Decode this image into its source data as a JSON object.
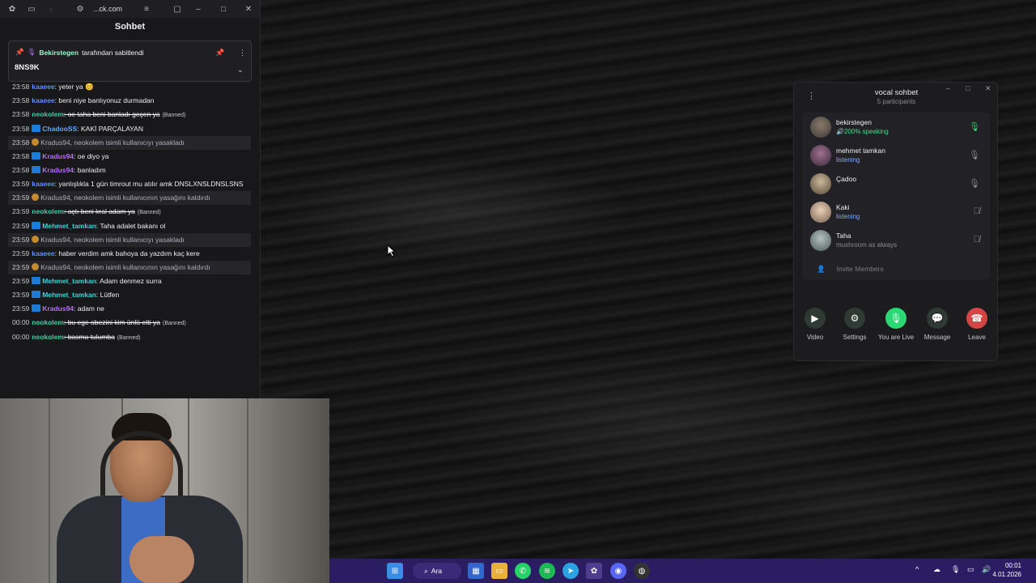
{
  "browser": {
    "url": "...ck.com"
  },
  "chat": {
    "title": "Sohbet",
    "pinned": {
      "user": "Bekirstegen",
      "suffix": " tarafından sabitlendi",
      "message": "8NS9K"
    },
    "messages": [
      {
        "time": "23:58",
        "user": "kaaeee",
        "color": "#5f8cff",
        "text": ": yeter ya 😊"
      },
      {
        "time": "23:58",
        "user": "kaaeee",
        "color": "#5f8cff",
        "text": ": beni niye banlıyonuz durmadan"
      },
      {
        "time": "23:58",
        "user": "neokolem",
        "color": "#2fd3a7",
        "text": ": oe taha beni banladı geçen ya",
        "banned": "(Banned)"
      },
      {
        "time": "23:58",
        "user": "ChadooSS",
        "color": "#5fa8ff",
        "text": ": KAKİ PARÇALAYAN"
      },
      {
        "time": "23:58",
        "sys": "Kradus94, neokolem isimli kullanıcıyı yasakladı"
      },
      {
        "time": "23:58",
        "user": "Kradus94",
        "color": "#b66bff",
        "text": ": oe diyo ya"
      },
      {
        "time": "23:58",
        "user": "Kradus94",
        "color": "#b66bff",
        "text": ": banladım"
      },
      {
        "time": "23:59",
        "user": "kaaeee",
        "color": "#5f8cff",
        "text": ": yanlışlıkla 1 gün timrout mu atılır amk DNSLXNSLDNSLSNS"
      },
      {
        "time": "23:59",
        "sys": "Kradus94, neokolem isimli kullanıcının yasağını kaldırdı"
      },
      {
        "time": "23:59",
        "user": "neokolem",
        "color": "#2fd3a7",
        "text": ": açtı beni kral adam ya",
        "banned": "(Banned)"
      },
      {
        "time": "23:59",
        "user": "Mehmet_tamkan",
        "color": "#33d6d6",
        "text": ": Taha adalet bakanı ol"
      },
      {
        "time": "23:59",
        "sys": "Kradus94, neokolem isimli kullanıcıyı yasakladı"
      },
      {
        "time": "23:59",
        "user": "kaaeee",
        "color": "#5f8cff",
        "text": ": haber verdim amk bahoya da yazdım kaç kere"
      },
      {
        "time": "23:59",
        "sys": "Kradus94, neokolem isimli kullanıcının yasağını kaldırdı"
      },
      {
        "time": "23:59",
        "user": "Mehmet_tamkan",
        "color": "#33d6d6",
        "text": ": Adam denmez surra"
      },
      {
        "time": "23:59",
        "user": "Mehmet_tamkan",
        "color": "#33d6d6",
        "text": ": Lütfen"
      },
      {
        "time": "23:59",
        "user": "Kradus94",
        "color": "#b66bff",
        "text": ": adam ne"
      },
      {
        "time": "00:00",
        "user": "neokolem",
        "color": "#2fd3a7",
        "text": ": bu ege obezini kim ünlü etti ya",
        "banned": "(Banned)"
      },
      {
        "time": "00:00",
        "user": "neokolem",
        "color": "#2fd3a7",
        "text": ": basma tulumba",
        "banned": "(Banned)"
      }
    ]
  },
  "voice": {
    "title": "vocal sohbet",
    "subtitle": "5 participants",
    "participants": [
      {
        "name": "bekirstegen",
        "status": "200% speaking",
        "state": "speaking",
        "mic": "on"
      },
      {
        "name": "mehmet tamkan",
        "status": "listening",
        "state": "listening",
        "mic": "off"
      },
      {
        "name": "Çadoo",
        "status": "",
        "state": "idle",
        "mic": "off"
      },
      {
        "name": "Kaki",
        "status": "listening",
        "state": "listening",
        "mic": "muted"
      },
      {
        "name": "Taha",
        "status": "mushroom as always",
        "state": "muted",
        "mic": "muted"
      }
    ],
    "invite_label": "Invite Members",
    "actions": {
      "video": "Video",
      "settings": "Settings",
      "live": "You are Live",
      "message": "Message",
      "leave": "Leave"
    },
    "colors": {
      "live": "#2bd873",
      "leave": "#d44545",
      "neutral": "#2f3a34"
    }
  },
  "taskbar": {
    "search_label": "Ara",
    "time": "00:01",
    "date": "4.01.2026"
  }
}
